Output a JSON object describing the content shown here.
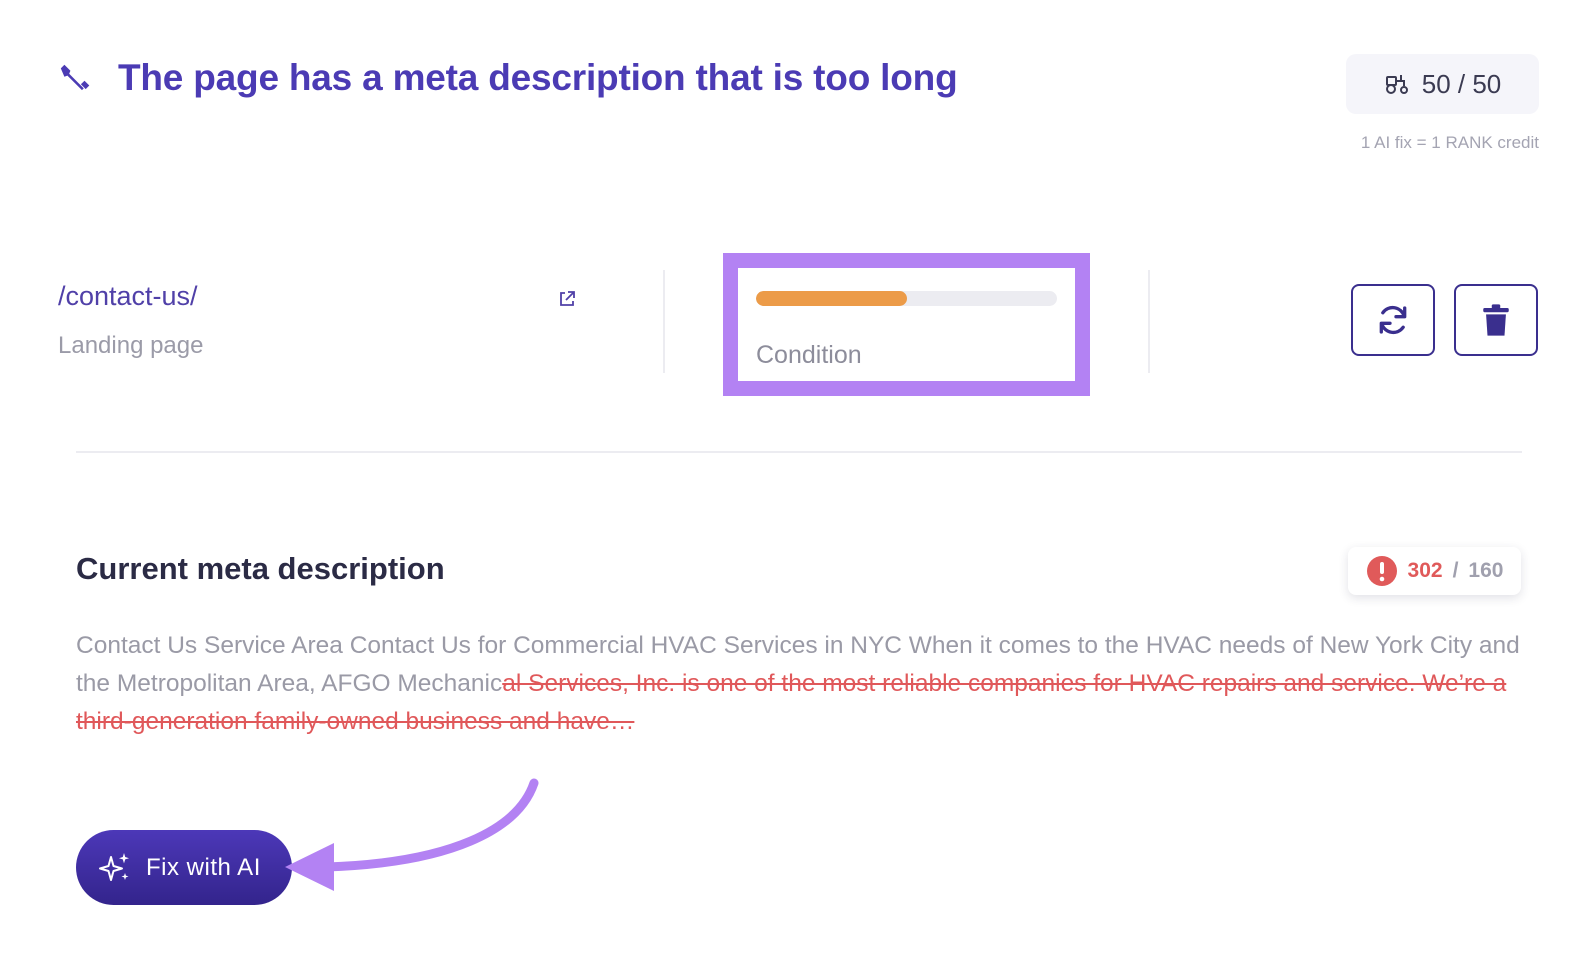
{
  "header": {
    "title": "The page has a meta description that is too long",
    "credits": "50 / 50",
    "credits_note": "1 AI fix = 1 RANK credit"
  },
  "page": {
    "path": "/contact-us/",
    "type": "Landing page"
  },
  "condition": {
    "label": "Condition",
    "level": 0.5,
    "color": "#ec9b48"
  },
  "meta": {
    "title": "Current meta description",
    "count_current": "302",
    "count_separator": "/",
    "count_max": "160",
    "text_ok": "Contact Us Service Area Contact Us for Commercial HVAC Services in NYC When it comes to the HVAC needs of New York City and the Metropolitan Area, AFGO Mechanic",
    "text_over": "al Services, Inc. is one of the most reliable companies for HVAC repairs and service. We’re a third-generation family-owned business and have…"
  },
  "actions": {
    "fix_label": "Fix with AI"
  },
  "colors": {
    "brand": "#4b3bb4",
    "highlight": "#b382f3",
    "error": "#e05a5a"
  },
  "icons": [
    "wrench-icon",
    "tractor-icon",
    "external-link-icon",
    "refresh-icon",
    "trash-icon",
    "error-icon",
    "sparkles-icon",
    "arrow-annotation"
  ]
}
